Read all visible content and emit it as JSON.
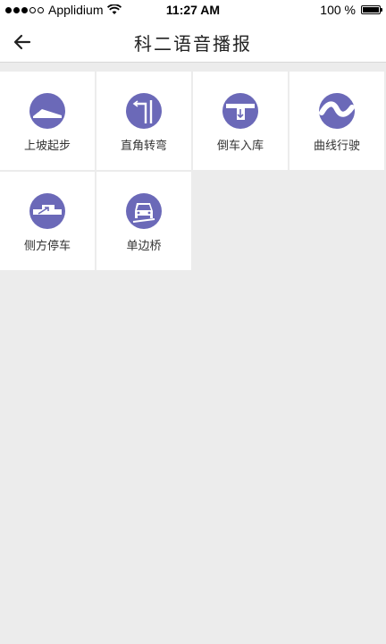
{
  "status_bar": {
    "carrier": "Applidium",
    "time": "11:27 AM",
    "battery": "100 %",
    "battery_level": 1.0
  },
  "nav": {
    "title": "科二语音播报"
  },
  "items": [
    {
      "label": "上坡起步",
      "icon": "uphill-start-icon"
    },
    {
      "label": "直角转弯",
      "icon": "right-angle-turn-icon"
    },
    {
      "label": "倒车入库",
      "icon": "reverse-parking-icon"
    },
    {
      "label": "曲线行驶",
      "icon": "curve-driving-icon"
    },
    {
      "label": "侧方停车",
      "icon": "parallel-parking-icon"
    },
    {
      "label": "单边桥",
      "icon": "single-bridge-icon"
    }
  ],
  "colors": {
    "icon_fill": "#6b69b8",
    "tile_bg": "#ffffff",
    "page_bg": "#ececec"
  }
}
